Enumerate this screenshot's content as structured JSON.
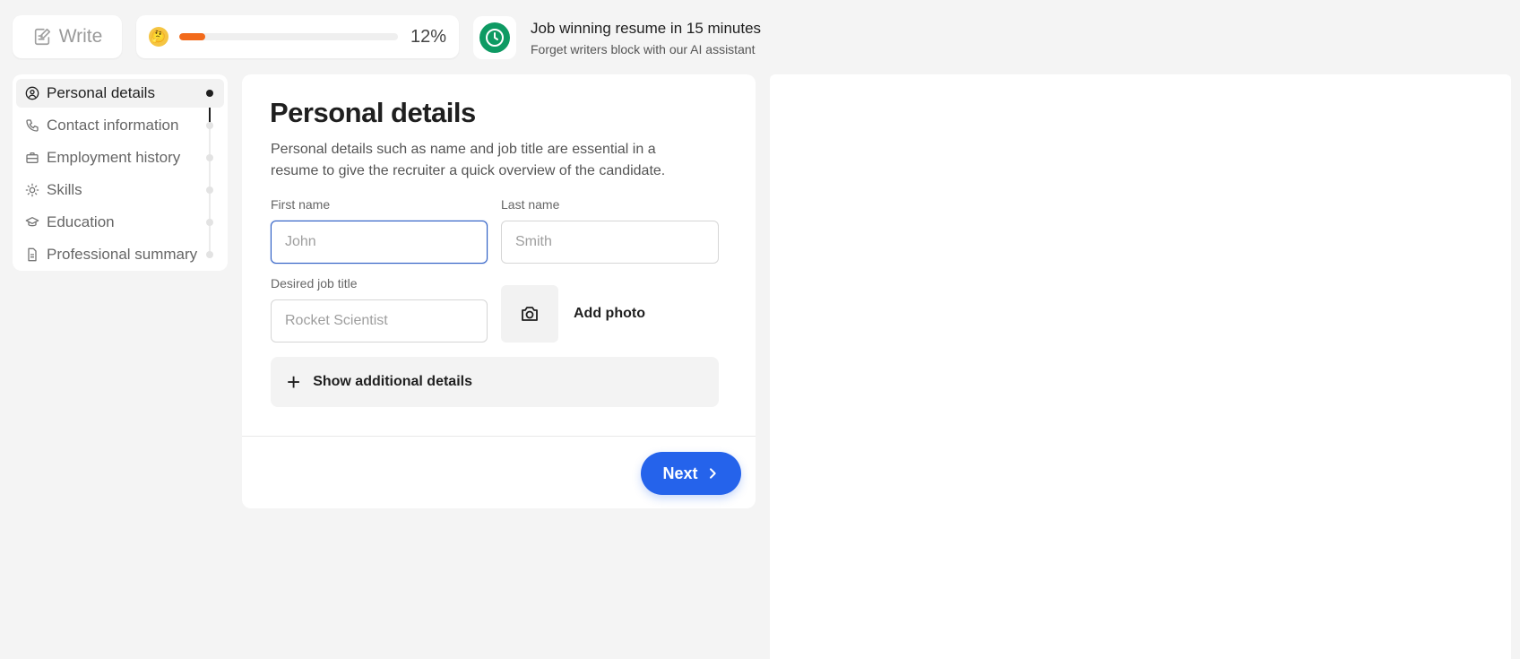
{
  "topbar": {
    "write_label": "Write",
    "progress_percent_text": "12%",
    "progress_value": 0.12,
    "ai_title": "Job winning resume in 15 minutes",
    "ai_subtitle": "Forget writers block with our AI assistant"
  },
  "sidebar": {
    "items": [
      {
        "label": "Personal details",
        "icon": "user-circle-icon",
        "active": true
      },
      {
        "label": "Contact information",
        "icon": "phone-icon",
        "active": false
      },
      {
        "label": "Employment history",
        "icon": "briefcase-icon",
        "active": false
      },
      {
        "label": "Skills",
        "icon": "skills-icon",
        "active": false
      },
      {
        "label": "Education",
        "icon": "graduation-cap-icon",
        "active": false
      },
      {
        "label": "Professional summary",
        "icon": "document-icon",
        "active": false
      }
    ]
  },
  "form": {
    "title": "Personal details",
    "description": "Personal details such as name and job title are essential in a resume to give the recruiter a quick overview of the candidate.",
    "first_name_label": "First name",
    "first_name_placeholder": "John",
    "last_name_label": "Last name",
    "last_name_placeholder": "Smith",
    "job_title_label": "Desired job title",
    "job_title_placeholder": "Rocket Scientist",
    "add_photo_label": "Add photo",
    "more_details_label": "Show additional details",
    "next_label": "Next"
  },
  "colors": {
    "accent": "#2563eb",
    "progress": "#f26a1b",
    "ai_icon": "#0e9a63"
  }
}
